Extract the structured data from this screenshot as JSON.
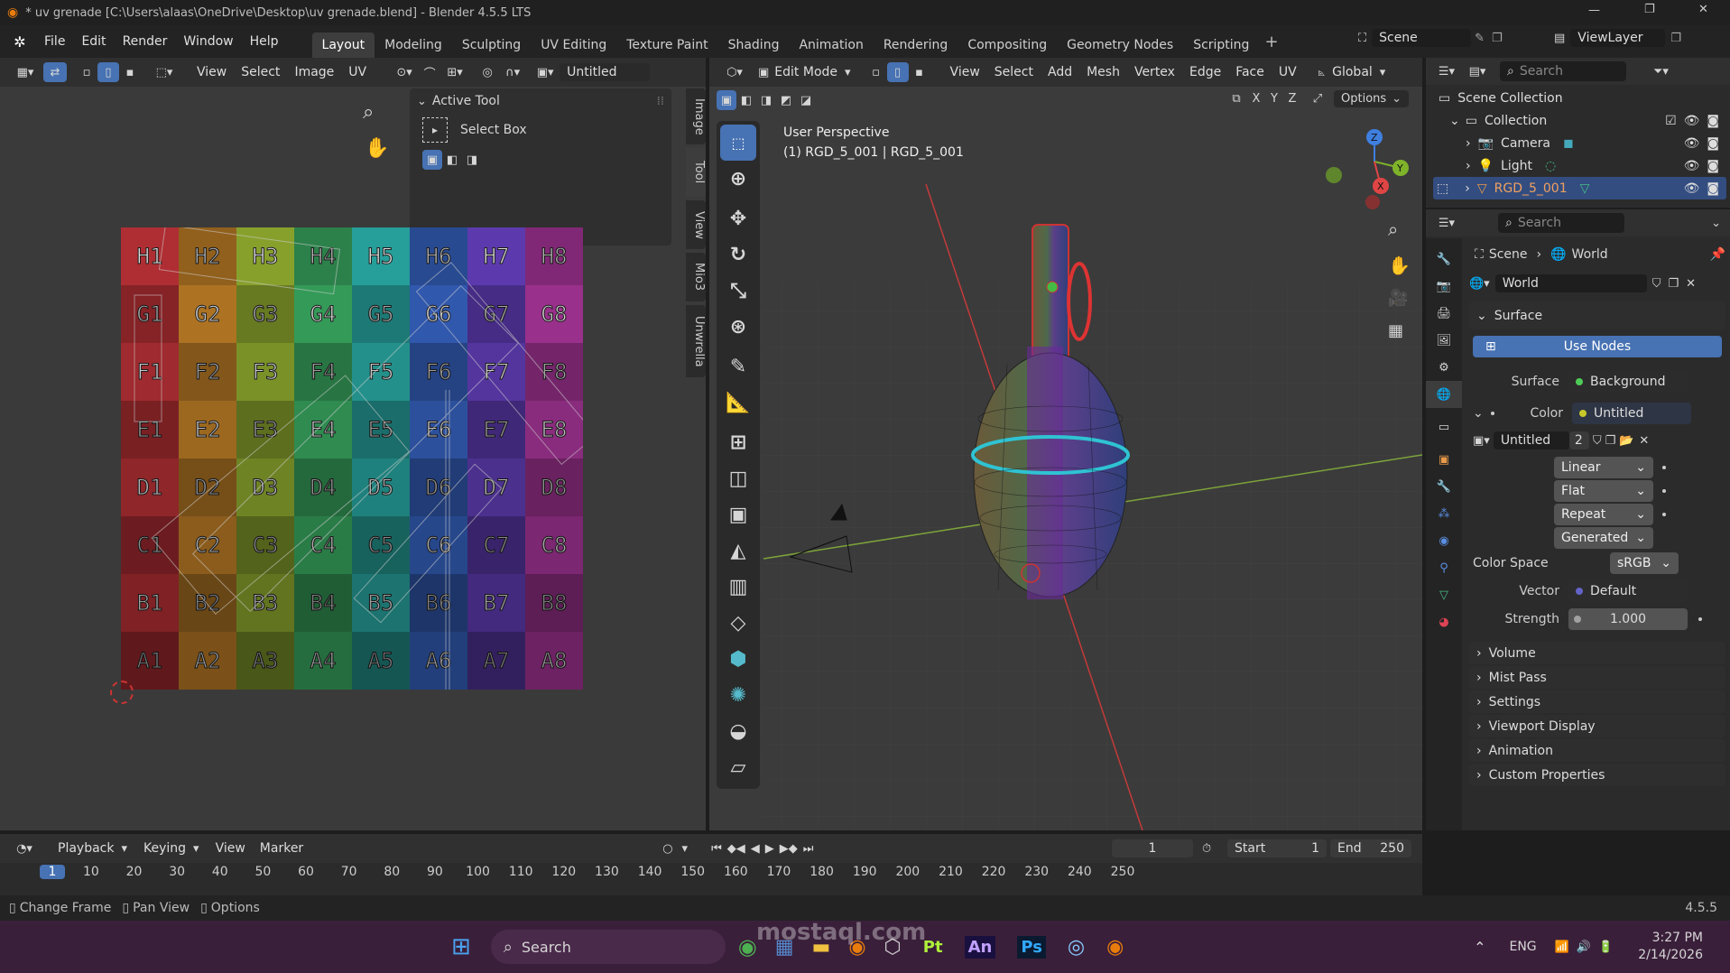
{
  "window": {
    "title": "* uv grenade [C:\\Users\\alaas\\OneDrive\\Desktop\\uv grenade.blend] - Blender 4.5.5 LTS"
  },
  "menu": [
    "File",
    "Edit",
    "Render",
    "Window",
    "Help"
  ],
  "workspaces": [
    "Layout",
    "Modeling",
    "Sculpting",
    "UV Editing",
    "Texture Paint",
    "Shading",
    "Animation",
    "Rendering",
    "Compositing",
    "Geometry Nodes",
    "Scripting"
  ],
  "scene": {
    "name": "Scene",
    "view_layer": "ViewLayer"
  },
  "uv_editor": {
    "menu": [
      "View",
      "Select",
      "Image",
      "UV"
    ],
    "image_name": "Untitled",
    "active_tool_title": "Active Tool",
    "active_tool_name": "Select Box",
    "side_tabs": [
      "Image",
      "Tool",
      "View",
      "Mio3",
      "Unwrella"
    ],
    "grid_rows": [
      [
        "H1",
        "H2",
        "H3",
        "H4",
        "H5",
        "H6",
        "H7",
        "H8"
      ],
      [
        "G1",
        "G2",
        "G3",
        "G4",
        "G5",
        "G6",
        "G7",
        "G8"
      ],
      [
        "F1",
        "F2",
        "F3",
        "F4",
        "F5",
        "F6",
        "F7",
        "F8"
      ],
      [
        "E1",
        "E2",
        "E3",
        "E4",
        "E5",
        "E6",
        "E7",
        "E8"
      ],
      [
        "D1",
        "D2",
        "D3",
        "D4",
        "D5",
        "D6",
        "D7",
        "D8"
      ],
      [
        "C1",
        "C2",
        "C3",
        "C4",
        "C5",
        "C6",
        "C7",
        "C8"
      ],
      [
        "B1",
        "B2",
        "B3",
        "B4",
        "B5",
        "B6",
        "B7",
        "B8"
      ],
      [
        "A1",
        "A2",
        "A3",
        "A4",
        "A5",
        "A6",
        "A7",
        "A8"
      ]
    ],
    "column_colors": [
      "#c9353b",
      "#d08a2a",
      "#9bb833",
      "#3fb96a",
      "#2cb6b0",
      "#3a6ad0",
      "#6a43c8",
      "#b83aa8"
    ]
  },
  "viewport": {
    "mode": "Edit Mode",
    "menu": [
      "View",
      "Select",
      "Add",
      "Mesh",
      "Vertex",
      "Edge",
      "Face",
      "UV"
    ],
    "orientation": "Global",
    "options_label": "Options",
    "axes_labels": [
      "X",
      "Y",
      "Z"
    ],
    "perspective_label": "User Perspective",
    "object_label": "(1) RGD_5_001 | RGD_5_001"
  },
  "outliner": {
    "search_placeholder": "Search",
    "root": "Scene Collection",
    "collection": "Collection",
    "items": [
      "Camera",
      "Light",
      "RGD_5_001"
    ]
  },
  "properties": {
    "search_placeholder": "Search",
    "breadcrumb": [
      "Scene",
      "World"
    ],
    "world_name": "World",
    "surface_section": "Surface",
    "use_nodes_label": "Use Nodes",
    "surface_label": "Surface",
    "surface_value": "Background",
    "color_label": "Color",
    "color_value": "Untitled",
    "image_name": "Untitled",
    "image_users": "2",
    "interpolation": "Linear",
    "projection": "Flat",
    "extension": "Repeat",
    "source": "Generated",
    "color_space_label": "Color Space",
    "color_space_value": "sRGB",
    "vector_label": "Vector",
    "vector_value": "Default",
    "strength_label": "Strength",
    "strength_value": "1.000",
    "collapsed_sections": [
      "Volume",
      "Mist Pass",
      "Settings",
      "Viewport Display",
      "Animation",
      "Custom Properties"
    ]
  },
  "timeline": {
    "menu": [
      "Playback",
      "Keying",
      "View",
      "Marker"
    ],
    "current_frame": "1",
    "start_label": "Start",
    "start_value": "1",
    "end_label": "End",
    "end_value": "250",
    "ruler": [
      "1",
      "10",
      "20",
      "30",
      "40",
      "50",
      "60",
      "70",
      "80",
      "90",
      "100",
      "110",
      "120",
      "130",
      "140",
      "150",
      "160",
      "170",
      "180",
      "190",
      "200",
      "210",
      "220",
      "230",
      "240",
      "250"
    ]
  },
  "statusbar": {
    "items": [
      "Change Frame",
      "Pan View",
      "Options"
    ],
    "version": "4.5.5"
  },
  "taskbar": {
    "search_label": "Search",
    "apps": [
      "Pt",
      "An",
      "Ps"
    ],
    "language": "ENG",
    "time": "3:27 PM",
    "date": "2/14/2026"
  },
  "watermark": "mostaql.com"
}
